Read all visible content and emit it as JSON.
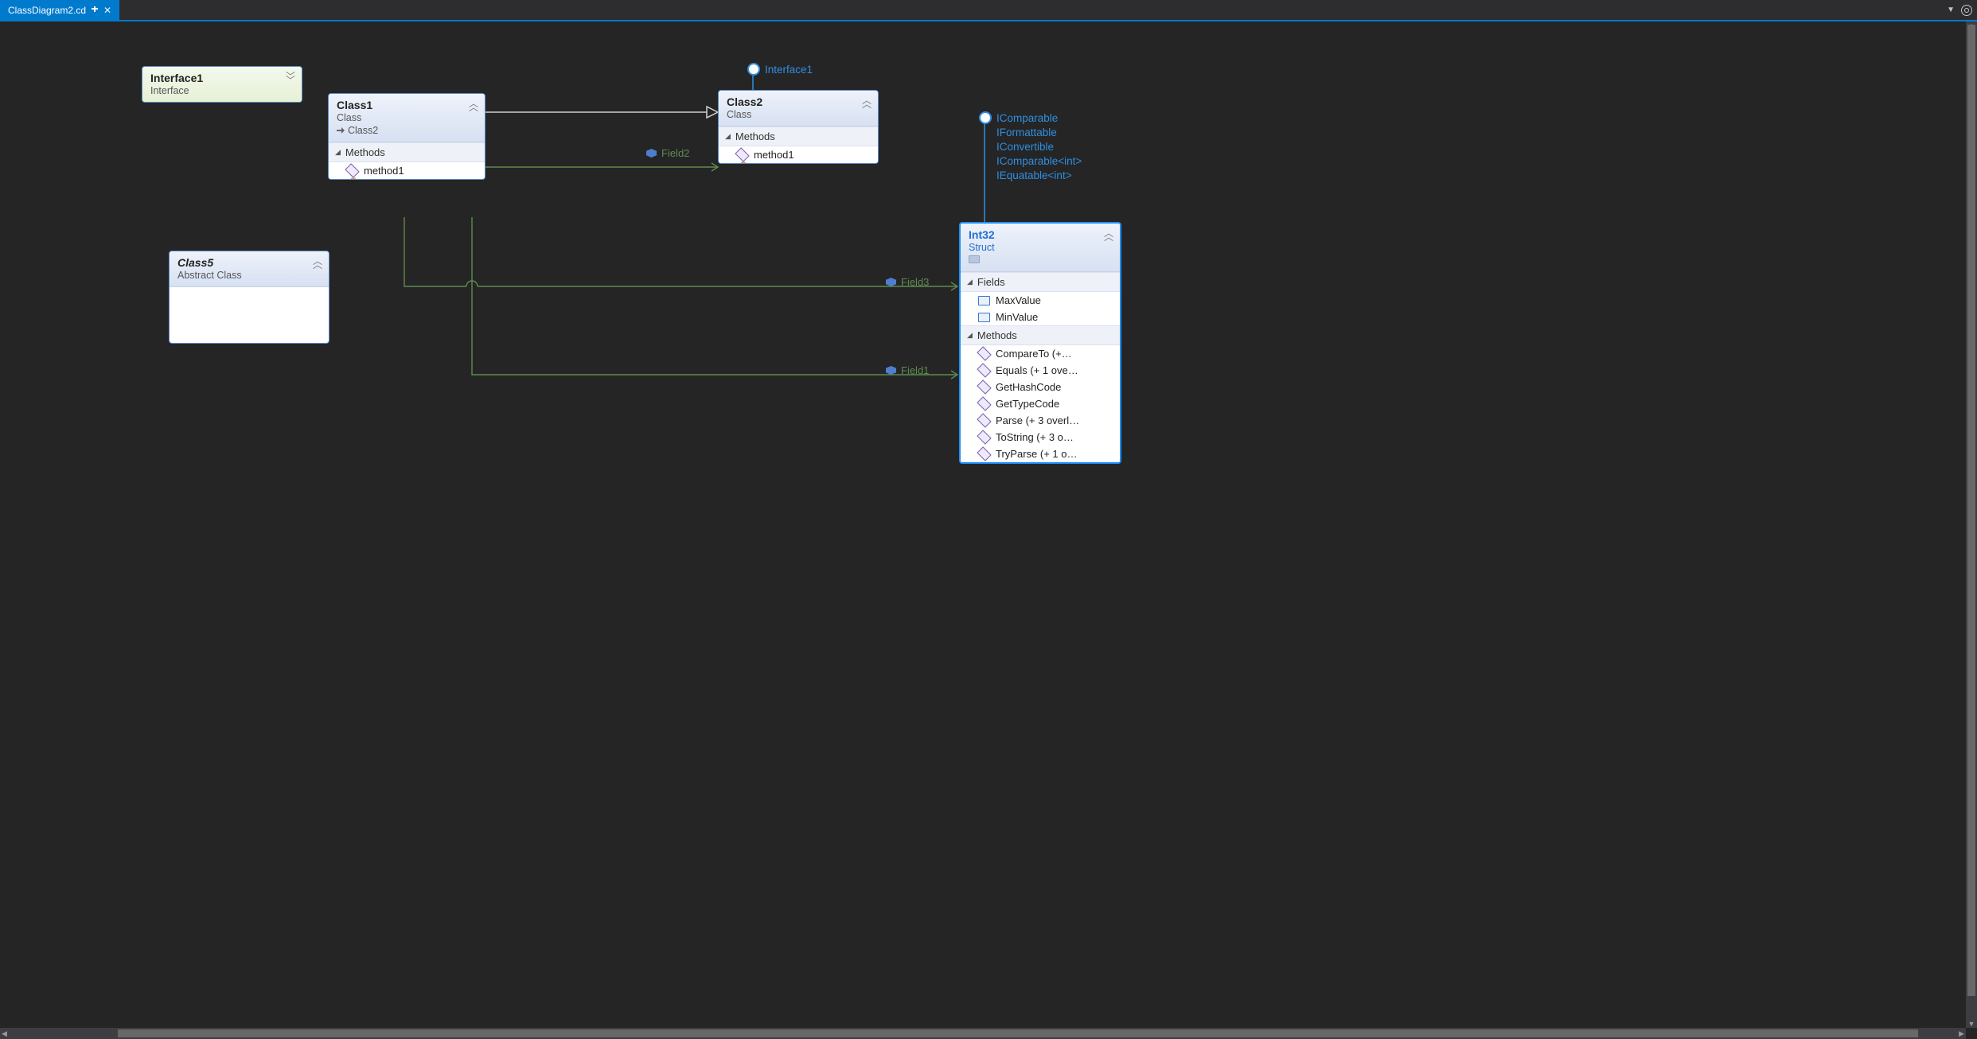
{
  "tab": {
    "title": "ClassDiagram2.cd"
  },
  "nodes": {
    "interface1": {
      "title": "Interface1",
      "subtitle": "Interface"
    },
    "class1": {
      "title": "Class1",
      "subtitle": "Class",
      "derived": "Class2",
      "sections": {
        "methods_label": "Methods"
      },
      "methods": [
        "method1"
      ]
    },
    "class2": {
      "title": "Class2",
      "subtitle": "Class",
      "sections": {
        "methods_label": "Methods"
      },
      "methods": [
        "method1"
      ]
    },
    "class5": {
      "title": "Class5",
      "subtitle": "Abstract Class"
    },
    "int32": {
      "title": "Int32",
      "subtitle": "Struct",
      "sections": {
        "fields_label": "Fields",
        "methods_label": "Methods"
      },
      "fields": [
        "MaxValue",
        "MinValue"
      ],
      "methods": [
        "CompareTo  (+…",
        "Equals (+ 1 ove…",
        "GetHashCode",
        "GetTypeCode",
        "Parse (+ 3 overl…",
        "ToString  (+ 3 o…",
        "TryParse  (+ 1 o…"
      ]
    }
  },
  "lollipops": {
    "class2": [
      "Interface1"
    ],
    "int32": [
      "IComparable",
      "IFormattable",
      "IConvertible",
      "IComparable<int>",
      "IEquatable<int>"
    ]
  },
  "edges": {
    "field2": "Field2",
    "field3": "Field3",
    "field1": "Field1"
  }
}
